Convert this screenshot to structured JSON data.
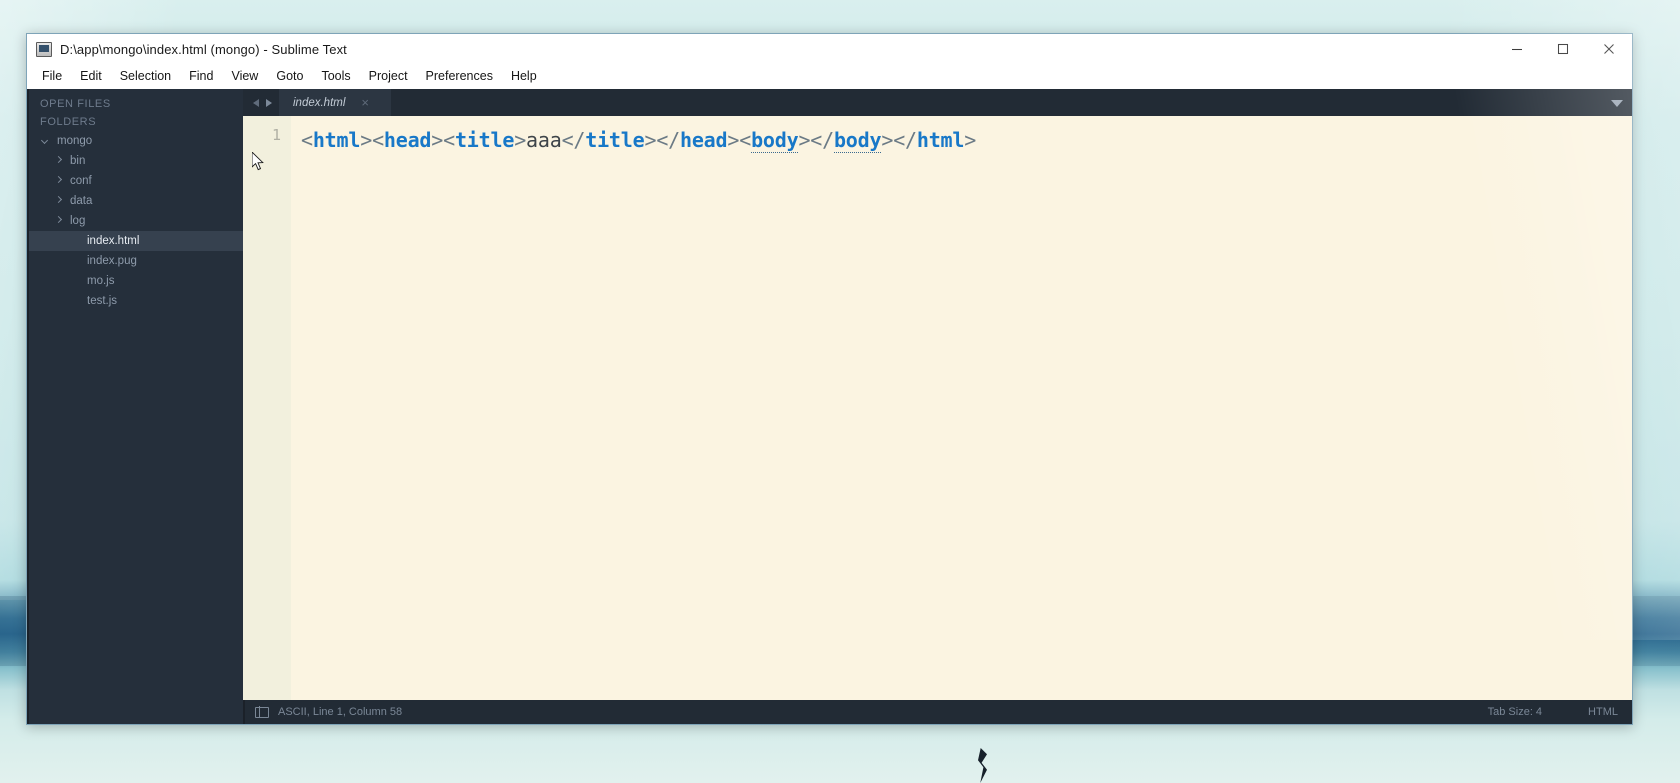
{
  "window": {
    "title": "D:\\app\\mongo\\index.html (mongo) - Sublime Text",
    "app_icon": "sublime-text-icon",
    "controls": {
      "minimize": "minimize-icon",
      "maximize": "maximize-icon",
      "close": "close-icon"
    }
  },
  "menubar": {
    "items": [
      {
        "label": "File"
      },
      {
        "label": "Edit"
      },
      {
        "label": "Selection"
      },
      {
        "label": "Find"
      },
      {
        "label": "View"
      },
      {
        "label": "Goto"
      },
      {
        "label": "Tools"
      },
      {
        "label": "Project"
      },
      {
        "label": "Preferences"
      },
      {
        "label": "Help"
      }
    ]
  },
  "sidebar": {
    "open_files_header": "OPEN FILES",
    "folders_header": "FOLDERS",
    "tree": [
      {
        "label": "mongo",
        "indent": 1,
        "arrow": "down",
        "selected": false
      },
      {
        "label": "bin",
        "indent": 2,
        "arrow": "right",
        "selected": false
      },
      {
        "label": "conf",
        "indent": 2,
        "arrow": "right",
        "selected": false
      },
      {
        "label": "data",
        "indent": 2,
        "arrow": "right",
        "selected": false
      },
      {
        "label": "log",
        "indent": 2,
        "arrow": "right",
        "selected": false
      },
      {
        "label": "index.html",
        "indent": 3,
        "arrow": "none",
        "selected": true
      },
      {
        "label": "index.pug",
        "indent": 3,
        "arrow": "none",
        "selected": false
      },
      {
        "label": "mo.js",
        "indent": 3,
        "arrow": "none",
        "selected": false
      },
      {
        "label": "test.js",
        "indent": 3,
        "arrow": "none",
        "selected": false
      }
    ]
  },
  "tabbar": {
    "prev_icon": "chevron-left-icon",
    "next_icon": "chevron-right-icon",
    "tabs": [
      {
        "label": "index.html",
        "active": true,
        "close_glyph": "×"
      }
    ],
    "menu_icon": "chevron-down-icon"
  },
  "editor": {
    "line_number": "1",
    "raw_line": "<html><head><title>aaa</title></head><body></body></html>",
    "tokens": [
      {
        "text": "<",
        "type": "punct"
      },
      {
        "text": "html",
        "type": "tag"
      },
      {
        "text": ">",
        "type": "punct"
      },
      {
        "text": "<",
        "type": "punct"
      },
      {
        "text": "head",
        "type": "tag"
      },
      {
        "text": ">",
        "type": "punct"
      },
      {
        "text": "<",
        "type": "punct"
      },
      {
        "text": "title",
        "type": "tag"
      },
      {
        "text": ">",
        "type": "punct"
      },
      {
        "text": "aaa",
        "type": "text"
      },
      {
        "text": "</",
        "type": "punct"
      },
      {
        "text": "title",
        "type": "tag"
      },
      {
        "text": ">",
        "type": "punct"
      },
      {
        "text": "</",
        "type": "punct"
      },
      {
        "text": "head",
        "type": "tag"
      },
      {
        "text": ">",
        "type": "punct"
      },
      {
        "text": "<",
        "type": "punct"
      },
      {
        "text": "body",
        "type": "tag-underline"
      },
      {
        "text": ">",
        "type": "punct"
      },
      {
        "text": "</",
        "type": "punct"
      },
      {
        "text": "body",
        "type": "tag-underline"
      },
      {
        "text": ">",
        "type": "punct"
      },
      {
        "text": "</",
        "type": "punct"
      },
      {
        "text": "html",
        "type": "tag"
      },
      {
        "text": ">",
        "type": "punct"
      }
    ]
  },
  "statusbar": {
    "toggle_icon": "sidebar-toggle-icon",
    "encoding_position": "ASCII, Line 1, Column 58",
    "tab_size": "Tab Size: 4",
    "syntax": "HTML"
  },
  "colors": {
    "window_chrome": "#ffffff",
    "sidebar_bg": "#252f3b",
    "sidebar_selected": "#36414f",
    "editor_bg": "#fbf4e1",
    "gutter_bg": "#f2f0dd",
    "tag_blue": "#1878c8",
    "punct_gray": "#6b7a85",
    "text_dark": "#3e4449",
    "status_bg": "#222b35",
    "desktop_top": "#d9efee",
    "desktop_band": "#2f6f98"
  }
}
